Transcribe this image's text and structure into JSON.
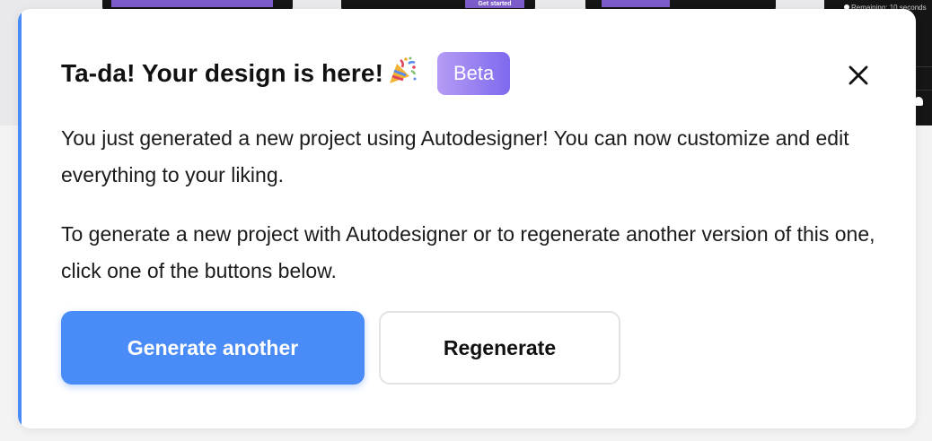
{
  "background": {
    "thumbnail_cta": "Get started",
    "remaining_text": "Remaining: 10 seconds"
  },
  "modal": {
    "title": "Ta-da! Your design is here!",
    "title_icon": "party-popper-icon",
    "badge": "Beta",
    "close_icon": "close-icon",
    "paragraph_1": "You just generated a new project using Autodesigner! You can now customize and edit everything to your liking.",
    "paragraph_2": "To generate a new project with Autodesigner or to regenerate another version of this one, click one of the buttons below.",
    "primary_button": "Generate another",
    "secondary_button": "Regenerate"
  },
  "colors": {
    "accent": "#4a8cf7",
    "badge_start": "#b59cf5",
    "badge_end": "#7f69ee",
    "text": "#111111"
  }
}
